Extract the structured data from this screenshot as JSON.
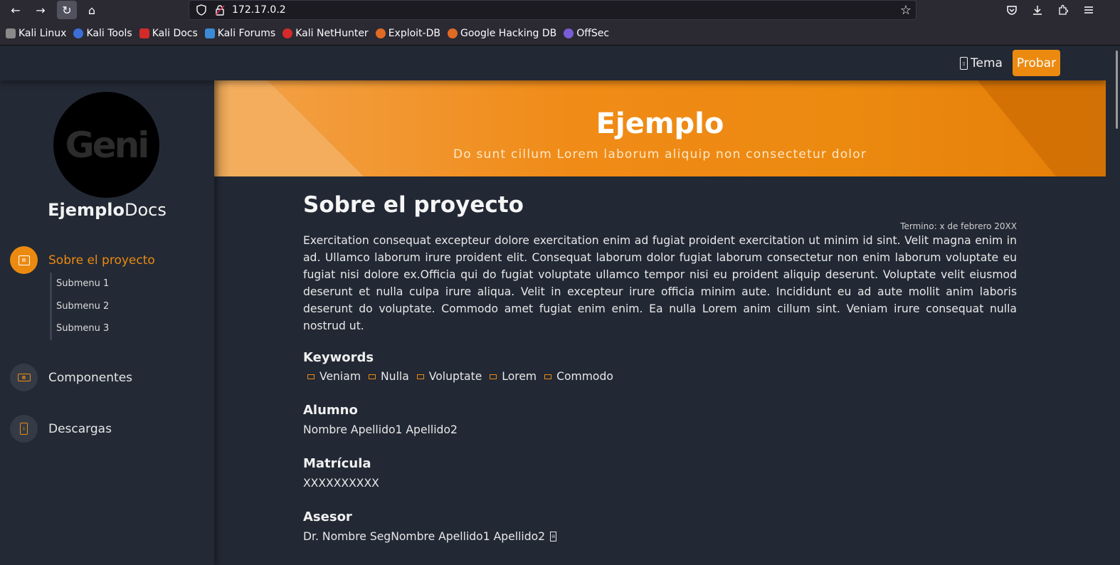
{
  "browser": {
    "url": "172.17.0.2",
    "bookmarks": [
      {
        "label": "Kali Linux",
        "color": "#8a8a8a"
      },
      {
        "label": "Kali Tools",
        "color": "#3b6fd6"
      },
      {
        "label": "Kali Docs",
        "color": "#d42a2a"
      },
      {
        "label": "Kali Forums",
        "color": "#3b8ad6"
      },
      {
        "label": "Kali NetHunter",
        "color": "#d42a2a"
      },
      {
        "label": "Exploit-DB",
        "color": "#e06a24"
      },
      {
        "label": "Google Hacking DB",
        "color": "#e06a24"
      },
      {
        "label": "OffSec",
        "color": "#7a5cd6"
      }
    ]
  },
  "topbar": {
    "theme_label": "Tema",
    "try_label": "Probar"
  },
  "sidebar": {
    "logo_text": "Geni",
    "brand_bold": "Ejemplo",
    "brand_light": "Docs",
    "items": [
      {
        "label": "Sobre el proyecto",
        "icon": "book-icon",
        "active": true
      },
      {
        "label": "Componentes",
        "icon": "components-icon",
        "active": false
      },
      {
        "label": "Descargas",
        "icon": "download-icon",
        "active": false
      }
    ],
    "submenu": [
      "Submenu 1",
      "Submenu 2",
      "Submenu 3"
    ]
  },
  "hero": {
    "title": "Ejemplo",
    "subtitle": "Do sunt cillum Lorem laborum aliquip non consectetur dolor"
  },
  "main": {
    "title": "Sobre el proyecto",
    "term": "Termino: x de febrero 20XX",
    "paragraph": "Exercitation consequat excepteur dolore exercitation enim ad fugiat proident exercitation ut minim id sint. Velit magna enim in ad. Ullamco laborum irure proident elit. Consequat laborum dolor fugiat laborum consectetur non enim laborum voluptate eu fugiat nisi dolore ex.Officia qui do fugiat voluptate ullamco tempor nisi eu proident aliquip deserunt. Voluptate velit eiusmod deserunt et nulla culpa irure aliqua. Velit in excepteur irure officia minim aute. Incididunt eu ad aute mollit anim laboris deserunt do voluptate. Commodo amet fugiat enim enim. Ea nulla Lorem anim cillum sint. Veniam irure consequat nulla nostrud ut.",
    "keywords_title": "Keywords",
    "keywords": [
      "Veniam",
      "Nulla",
      "Voluptate",
      "Lorem",
      "Commodo"
    ],
    "student_title": "Alumno",
    "student_name": "Nombre Apellido1 Apellido2",
    "id_title": "Matrícula",
    "id_value": "XXXXXXXXXX",
    "advisor_title": "Asesor",
    "advisor_name": "Dr. Nombre SegNombre Apellido1 Apellido2"
  },
  "colors": {
    "accent": "#ec8a10",
    "background": "#222834",
    "sidebar": "#232a35"
  }
}
